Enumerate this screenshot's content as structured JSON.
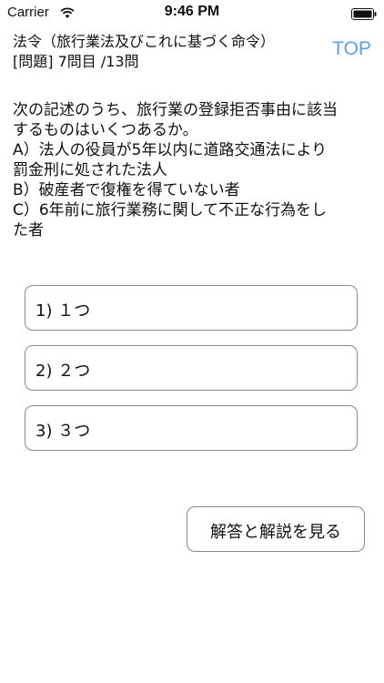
{
  "status_bar": {
    "carrier": "Carrier",
    "time": "9:46 PM"
  },
  "header": {
    "title": "法令（旅行業法及びこれに基づく命令）",
    "subtitle": "[問題] 7問目 /13問",
    "top_label": "TOP",
    "accent_color": "#5ba0f2"
  },
  "question": {
    "lines": [
      "次の記述のうち、旅行業の登録拒否事由に該当",
      "するものはいくつあるか。",
      "A）法人の役員が5年以内に道路交通法により",
      "罰金刑に処された法人",
      "B）破産者で復権を得ていない者",
      "C）6年前に旅行業務に関して不正な行為をし",
      "た者"
    ]
  },
  "choices": [
    {
      "label": "1) １つ"
    },
    {
      "label": "2) ２つ"
    },
    {
      "label": "3) ３つ"
    }
  ],
  "answer_button": {
    "label": "解答と解説を見る"
  },
  "icons": [
    "wifi-icon",
    "battery-icon"
  ]
}
